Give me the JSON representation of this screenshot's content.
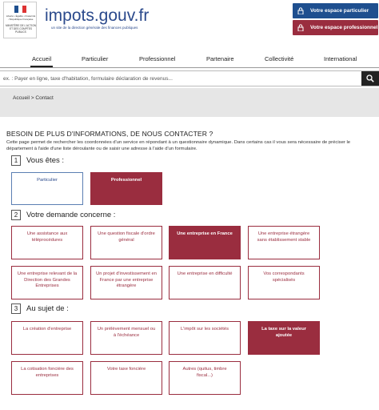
{
  "header": {
    "logo_small": "Liberté • Égalité • Fraternité / République Française",
    "logo_ministry": "MINISTÈRE DE L'ACTION ET DES COMPTES PUBLICS",
    "site_title": "impots.gouv.fr",
    "site_sub": "un site de la direction générale des finances publiques",
    "btn_particulier": "Votre espace particulier",
    "btn_professionnel": "Votre espace professionnel"
  },
  "nav": {
    "items": [
      "Accueil",
      "Particulier",
      "Professionnel",
      "Partenaire",
      "Collectivité",
      "International"
    ]
  },
  "search": {
    "placeholder": "ex. : Payer en ligne, taxe d'habitation, formulaire déclaration de revenus..."
  },
  "breadcrumb": {
    "home": "Accueil",
    "sep": " > ",
    "current": "Contact"
  },
  "main": {
    "title": "BESOIN DE PLUS D'INFORMATIONS, DE NOUS CONTACTER ?",
    "intro": "Cette page permet de rechercher les coordonnées d'un service en répondant à un questionnaire dynamique. Dans certains cas il vous sera nécessaire de préciser le département à l'aide d'une liste déroulante ou de saisir une adresse à l'aide d'un formulaire."
  },
  "steps": [
    {
      "num": "1",
      "label": "Vous êtes :"
    },
    {
      "num": "2",
      "label": "Votre demande concerne :"
    },
    {
      "num": "3",
      "label": "Au sujet de :"
    }
  ],
  "step1_cards": [
    "Particulier",
    "Professionnel"
  ],
  "step2_cards": [
    "Une assistance aux téléprocédures",
    "Une question fiscale d'ordre général",
    "Une entreprise en France",
    "Une entreprise étrangère sans établissement stable",
    "Une entreprise relevant de la Direction des Grandes Entreprises",
    "Un projet d'investissement en France par une entreprise étrangère",
    "Une entreprise en difficulté",
    "Vos correspondants spécialisés"
  ],
  "step3_cards": [
    "La création d'entreprise",
    "Un prélèvement mensuel ou à l'échéance",
    "L'impôt sur les sociétés",
    "La taxe sur la valeur ajoutée",
    "La cotisation foncière des entreprises",
    "Votre taxe foncière",
    "Autres (quitus, timbre fiscal...)"
  ],
  "colors": {
    "brand_blue": "#1e4f8f",
    "brand_red": "#9a2d3f",
    "title_blue": "#2b4a8c"
  }
}
